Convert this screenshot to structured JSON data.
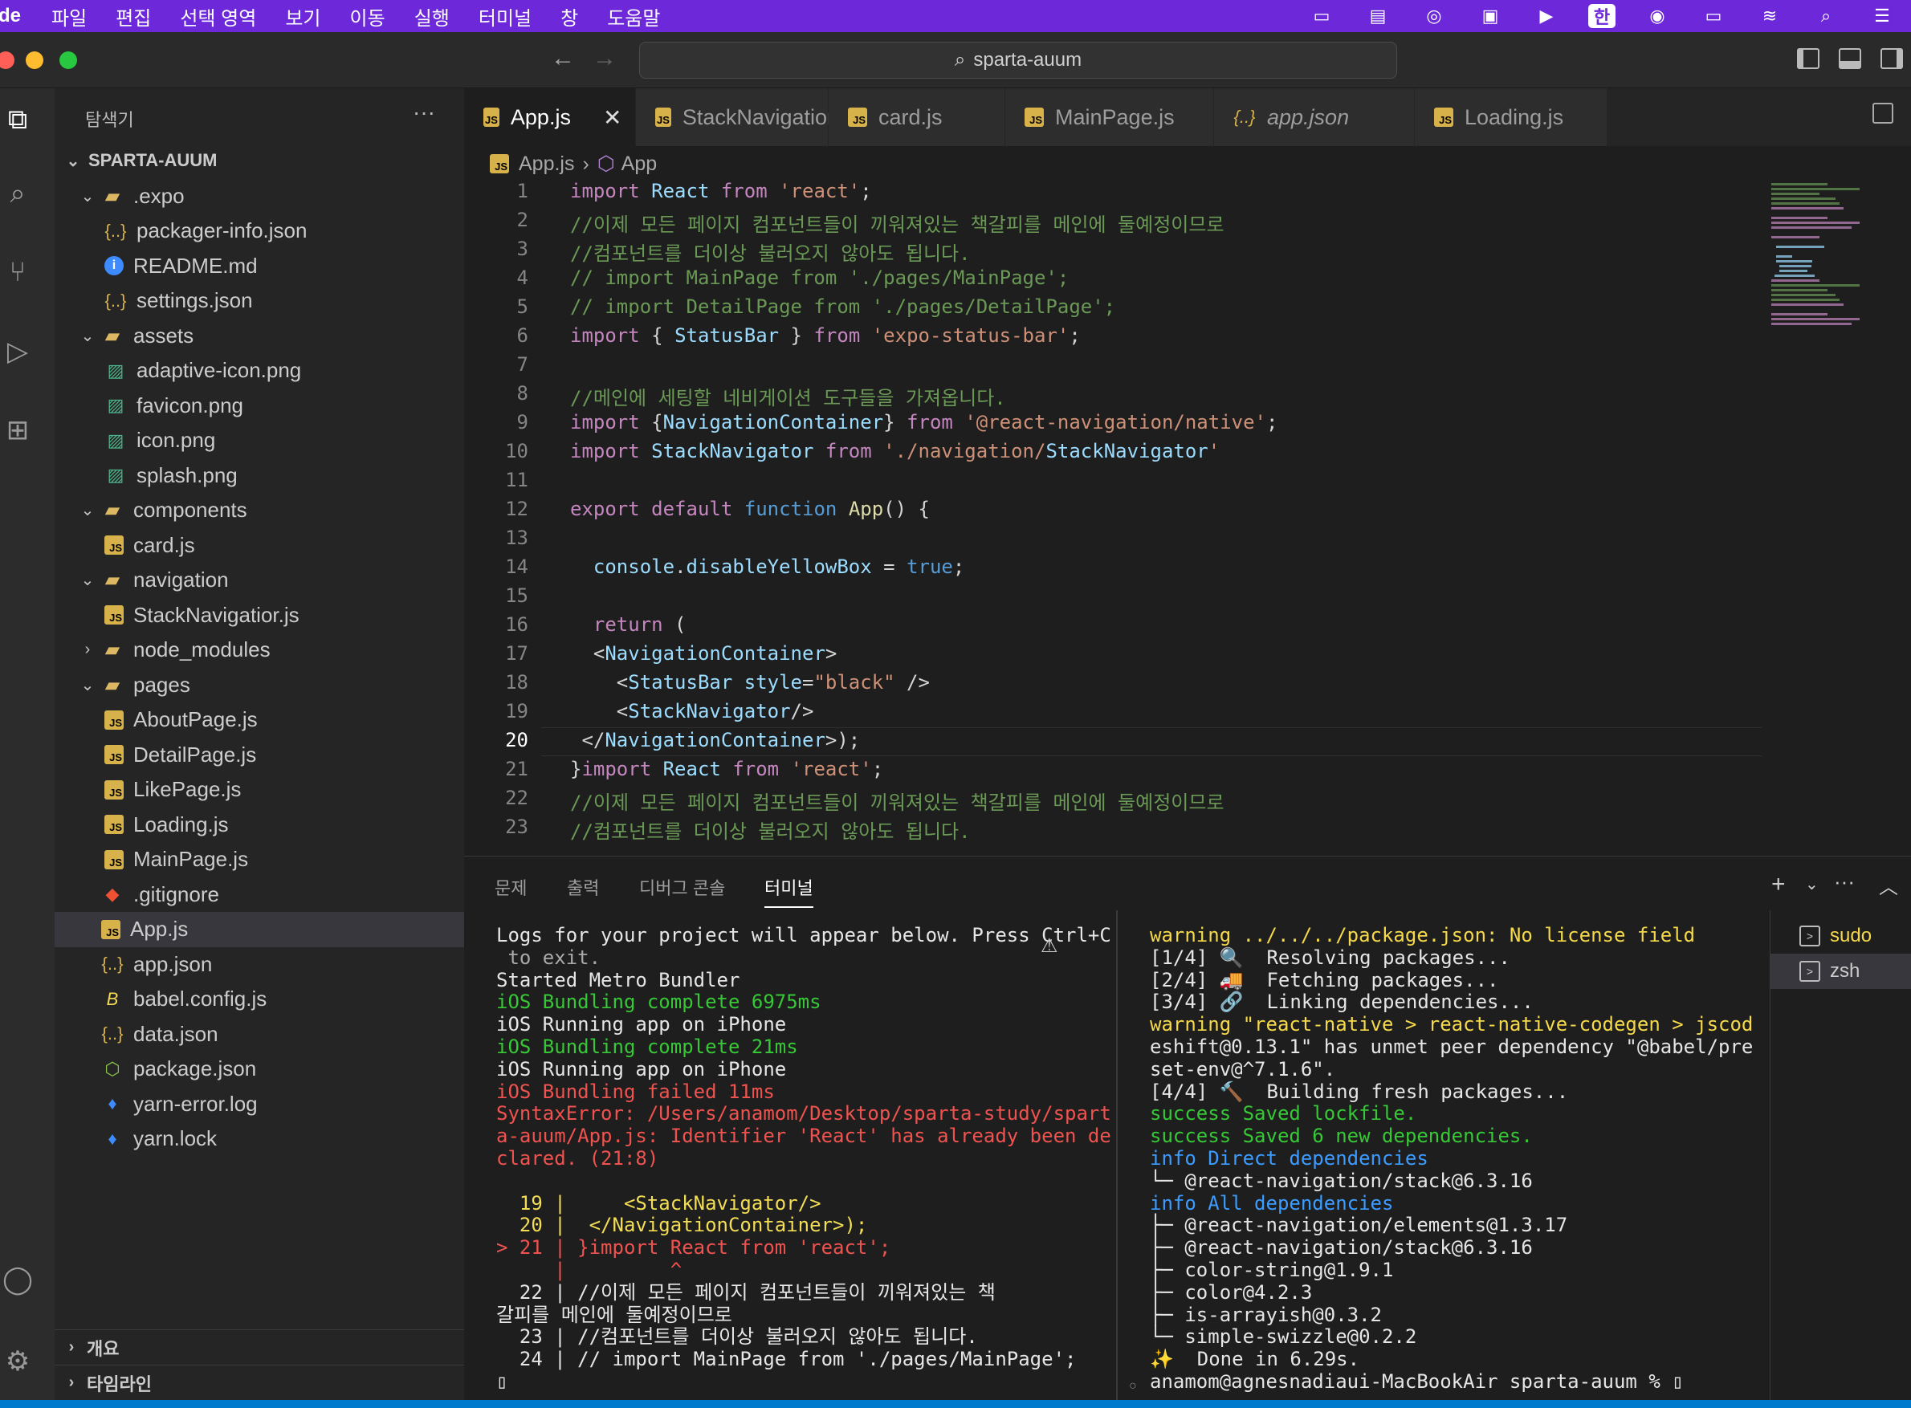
{
  "menubar": {
    "app": "Code",
    "items": [
      "파일",
      "편집",
      "선택 영역",
      "보기",
      "이동",
      "실행",
      "터미널",
      "창",
      "도움말"
    ],
    "status_icons": [
      "display-icon",
      "notes-icon",
      "creative-cloud-icon",
      "screen-mirror-icon",
      "play-icon",
      "input-source-icon",
      "airdrop-icon",
      "battery-icon",
      "wifi-icon",
      "search-icon",
      "control-center-icon"
    ],
    "input_source": "한"
  },
  "titlebar": {
    "search": "sparta-auum"
  },
  "sidebar": {
    "title": "탐색기",
    "root": "SPARTA-AUUM",
    "tree": [
      {
        "label": ".expo",
        "type": "folder-open",
        "depth": 1
      },
      {
        "label": "packager-info.json",
        "type": "json",
        "depth": 2
      },
      {
        "label": "README.md",
        "type": "info",
        "depth": 2
      },
      {
        "label": "settings.json",
        "type": "json",
        "depth": 2
      },
      {
        "label": "assets",
        "type": "folder-open",
        "depth": 1
      },
      {
        "label": "adaptive-icon.png",
        "type": "png",
        "depth": 2
      },
      {
        "label": "favicon.png",
        "type": "png",
        "depth": 2
      },
      {
        "label": "icon.png",
        "type": "png",
        "depth": 2
      },
      {
        "label": "splash.png",
        "type": "png",
        "depth": 2
      },
      {
        "label": "components",
        "type": "folder-open",
        "depth": 1
      },
      {
        "label": "card.js",
        "type": "js",
        "depth": 2
      },
      {
        "label": "navigation",
        "type": "folder-open",
        "depth": 1
      },
      {
        "label": "StackNavigatior.js",
        "type": "js",
        "depth": 2
      },
      {
        "label": "node_modules",
        "type": "folder-closed",
        "depth": 1
      },
      {
        "label": "pages",
        "type": "folder-open",
        "depth": 1
      },
      {
        "label": "AboutPage.js",
        "type": "js",
        "depth": 2
      },
      {
        "label": "DetailPage.js",
        "type": "js",
        "depth": 2
      },
      {
        "label": "LikePage.js",
        "type": "js",
        "depth": 2
      },
      {
        "label": "Loading.js",
        "type": "js",
        "depth": 2
      },
      {
        "label": "MainPage.js",
        "type": "js",
        "depth": 2
      },
      {
        "label": ".gitignore",
        "type": "git",
        "depth": 1
      },
      {
        "label": "App.js",
        "type": "js",
        "depth": 1,
        "selected": true
      },
      {
        "label": "app.json",
        "type": "json",
        "depth": 1
      },
      {
        "label": "babel.config.js",
        "type": "babel",
        "depth": 1
      },
      {
        "label": "data.json",
        "type": "json",
        "depth": 1
      },
      {
        "label": "package.json",
        "type": "pkg",
        "depth": 1
      },
      {
        "label": "yarn-error.log",
        "type": "yarn",
        "depth": 1
      },
      {
        "label": "yarn.lock",
        "type": "yarn",
        "depth": 1
      }
    ],
    "footer": [
      "개요",
      "타임라인"
    ]
  },
  "tabs": [
    {
      "label": "App.js",
      "active": true,
      "icon": "js"
    },
    {
      "label": "StackNavigatior.js",
      "icon": "js"
    },
    {
      "label": "card.js",
      "icon": "js"
    },
    {
      "label": "MainPage.js",
      "icon": "js"
    },
    {
      "label": "app.json",
      "icon": "json",
      "italic": true
    },
    {
      "label": "Loading.js",
      "icon": "js"
    }
  ],
  "breadcrumb": {
    "file": "App.js",
    "symbol": "App"
  },
  "editor": {
    "current_line": 20,
    "lines": [
      "import React from 'react';",
      "//이제 모든 페이지 컴포넌트들이 끼워져있는 책갈피를 메인에 둘예정이므로",
      "//컴포넌트를 더이상 불러오지 않아도 됩니다.",
      "// import MainPage from './pages/MainPage';",
      "// import DetailPage from './pages/DetailPage';",
      "import { StatusBar } from 'expo-status-bar';",
      "",
      "//메인에 세팅할 네비게이션 도구들을 가져옵니다.",
      "import {NavigationContainer} from '@react-navigation/native';",
      "import StackNavigator from './navigation/StackNavigator'",
      "",
      "export default function App() {",
      "",
      "  console.disableYellowBox = true;",
      "",
      "  return (",
      "  <NavigationContainer>",
      "    <StatusBar style=\"black\" />",
      "    <StackNavigator/>",
      " </NavigationContainer>);",
      "}import React from 'react';",
      "//이제 모든 페이지 컴포넌트들이 끼워져있는 책갈피를 메인에 둘예정이므로",
      "//컴포넌트를 더이상 불러오지 않아도 됩니다."
    ]
  },
  "panel": {
    "tabs": [
      "문제",
      "출력",
      "디버그 콘솔",
      "터미널"
    ],
    "active_tab": "터미널",
    "shells": [
      "sudo",
      "zsh"
    ],
    "left_terminal": [
      {
        "t": "Logs for your project will appear below. Press Ctrl+C",
        "c": ""
      },
      {
        "t": " to exit.",
        "c": "t-g"
      },
      {
        "t": "Started Metro Bundler",
        "c": ""
      },
      {
        "t": "iOS Bundling complete 6975ms",
        "c": "t-gr"
      },
      {
        "t": "iOS Running app on iPhone",
        "c": ""
      },
      {
        "t": "iOS Bundling complete 21ms",
        "c": "t-gr"
      },
      {
        "t": "iOS Running app on iPhone",
        "c": ""
      },
      {
        "t": "iOS Bundling failed 11ms",
        "c": "t-r"
      },
      {
        "t": "SyntaxError: /Users/anamom/Desktop/sparta-study/spart",
        "c": "t-r"
      },
      {
        "t": "a-auum/App.js: Identifier 'React' has already been de",
        "c": "t-r"
      },
      {
        "t": "clared. (21:8)",
        "c": "t-r"
      },
      {
        "t": "",
        "c": ""
      },
      {
        "t": "  19 |     <StackNavigator/>",
        "c": "t-y"
      },
      {
        "t": "  20 |  </NavigationContainer>);",
        "c": "t-y"
      },
      {
        "t": "> 21 | }import React from 'react';",
        "c": "t-r"
      },
      {
        "t": "     |         ^",
        "c": "t-r"
      },
      {
        "t": "  22 | //이제 모든 페이지 컴포넌트들이 끼워져있는 책",
        "c": ""
      },
      {
        "t": "갈피를 메인에 둘예정이므로",
        "c": ""
      },
      {
        "t": "  23 | //컴포넌트를 더이상 불러오지 않아도 됩니다.",
        "c": ""
      },
      {
        "t": "  24 | // import MainPage from './pages/MainPage';",
        "c": ""
      },
      {
        "t": "▯",
        "c": ""
      }
    ],
    "right_terminal": [
      {
        "t": "warning ../../../package.json: No license field",
        "c": "t-w"
      },
      {
        "t": "[1/4] 🔍  Resolving packages...",
        "c": ""
      },
      {
        "t": "[2/4] 🚚  Fetching packages...",
        "c": ""
      },
      {
        "t": "[3/4] 🔗  Linking dependencies...",
        "c": ""
      },
      {
        "t": "warning \"react-native > react-native-codegen > jscod",
        "c": "t-w"
      },
      {
        "t": "eshift@0.13.1\" has unmet peer dependency \"@babel/pre",
        "c": ""
      },
      {
        "t": "set-env@^7.1.6\".",
        "c": ""
      },
      {
        "t": "[4/4] 🔨  Building fresh packages...",
        "c": ""
      },
      {
        "t": "success Saved lockfile.",
        "c": "t-gr"
      },
      {
        "t": "success Saved 6 new dependencies.",
        "c": "t-gr"
      },
      {
        "t": "info Direct dependencies",
        "c": "t-c"
      },
      {
        "t": "└─ @react-navigation/stack@6.3.16",
        "c": ""
      },
      {
        "t": "info All dependencies",
        "c": "t-c"
      },
      {
        "t": "├─ @react-navigation/elements@1.3.17",
        "c": ""
      },
      {
        "t": "├─ @react-navigation/stack@6.3.16",
        "c": ""
      },
      {
        "t": "├─ color-string@1.9.1",
        "c": ""
      },
      {
        "t": "├─ color@4.2.3",
        "c": ""
      },
      {
        "t": "├─ is-arrayish@0.3.2",
        "c": ""
      },
      {
        "t": "└─ simple-swizzle@0.2.2",
        "c": ""
      },
      {
        "t": "✨  Done in 6.29s.",
        "c": ""
      },
      {
        "t": "anamom@agnesnadiaui-MacBookAir sparta-auum % ▯",
        "c": ""
      }
    ]
  },
  "colors": {
    "accent": "#6d28d9",
    "statusbar": "#007acc",
    "editor_bg": "#1e1e1e"
  }
}
